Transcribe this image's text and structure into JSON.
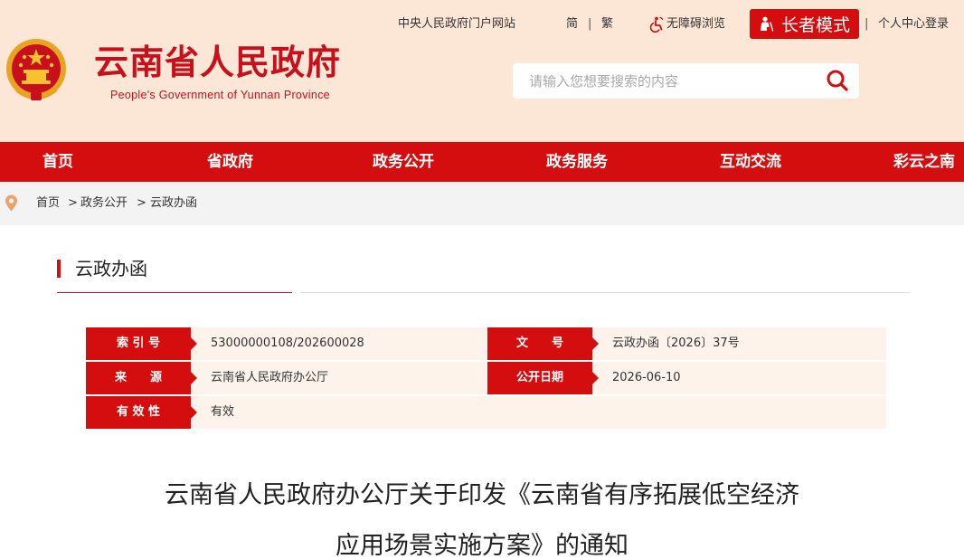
{
  "header": {
    "title": "云南省人民政府",
    "subtitle": "People's Government of Yunnan Province",
    "search_placeholder": "请输入您想要搜索的内容"
  },
  "toplinks": {
    "gov_portal": "中央人民政府门户网站",
    "simplified": "简",
    "separator": "|",
    "traditional": "繁",
    "accessibility": "无障碍浏览",
    "elder_mode": "长者模式",
    "user_center": "个人中心登录"
  },
  "nav": {
    "items": [
      "首页",
      "省政府",
      "政务公开",
      "政务服务",
      "互动交流",
      "彩云之南"
    ]
  },
  "breadcrumb": {
    "items": [
      "首页",
      "政务公开",
      "云政办函"
    ],
    "separator": ">"
  },
  "section": {
    "title": "云政办函"
  },
  "info": {
    "index_label": "索 引 号",
    "index_value": "53000000108/202600028",
    "doc_no_label": "文　　号",
    "doc_no_value": "云政办函〔2026〕37号",
    "source_label": "来　　源",
    "source_value": "云南省人民政府办公厅",
    "publish_label": "公开日期",
    "publish_value": "2026-06-10",
    "validity_label": "有 效 性",
    "validity_value": "有效"
  },
  "article": {
    "title_line1": "云南省人民政府办公厅关于印发《云南省有序拓展低空经济",
    "title_line2": "应用场景实施方案》的通知"
  },
  "colors": {
    "brand_red": "#d40e0e",
    "header_bg": "#fce6d6",
    "row_bg": "#fdf3ea"
  }
}
